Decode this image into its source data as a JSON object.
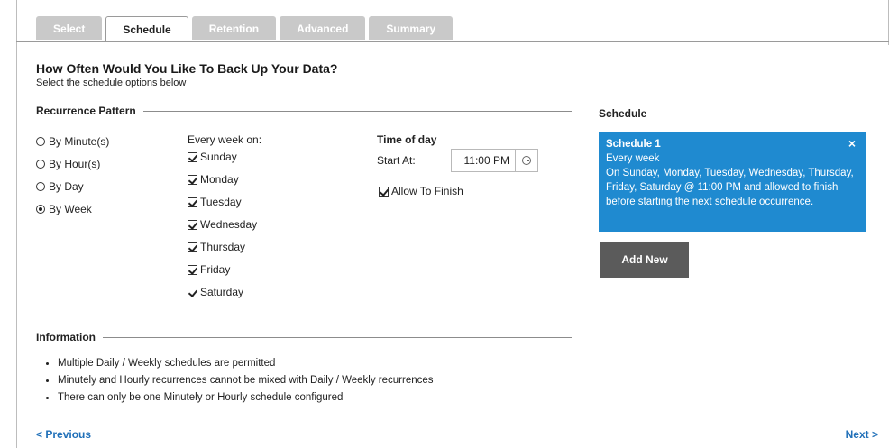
{
  "tabs": [
    {
      "label": "Select",
      "active": false
    },
    {
      "label": "Schedule",
      "active": true
    },
    {
      "label": "Retention",
      "active": false
    },
    {
      "label": "Advanced",
      "active": false
    },
    {
      "label": "Summary",
      "active": false
    }
  ],
  "page": {
    "heading": "How Often Would You Like To Back Up Your Data?",
    "subheading": "Select the schedule options below"
  },
  "recurrence": {
    "title": "Recurrence Pattern",
    "options": [
      {
        "label": "By Minute(s)",
        "selected": false
      },
      {
        "label": "By Hour(s)",
        "selected": false
      },
      {
        "label": "By Day",
        "selected": false
      },
      {
        "label": "By Week",
        "selected": true
      }
    ],
    "week_label": "Every week on:",
    "days": [
      {
        "label": "Sunday",
        "checked": true
      },
      {
        "label": "Monday",
        "checked": true
      },
      {
        "label": "Tuesday",
        "checked": true
      },
      {
        "label": "Wednesday",
        "checked": true
      },
      {
        "label": "Thursday",
        "checked": true
      },
      {
        "label": "Friday",
        "checked": true
      },
      {
        "label": "Saturday",
        "checked": true
      }
    ],
    "time_of_day_label": "Time of day",
    "start_at_label": "Start At:",
    "start_time": "11:00 PM",
    "allow_finish_label": "Allow To Finish",
    "allow_finish_checked": true
  },
  "schedule_panel": {
    "title": "Schedule",
    "card": {
      "name": "Schedule 1",
      "line1": "Every week",
      "description": "On Sunday, Monday, Tuesday, Wednesday, Thursday, Friday, Saturday @ 11:00 PM and allowed to finish before starting the next schedule occurrence.",
      "close_glyph": "×"
    },
    "add_new_label": "Add New",
    "accent_color": "#1f8ad0"
  },
  "information": {
    "title": "Information",
    "items": [
      "Multiple Daily / Weekly schedules are permitted",
      "Minutely and Hourly recurrences cannot be mixed with Daily / Weekly recurrences",
      "There can only be one Minutely or Hourly schedule configured"
    ]
  },
  "nav": {
    "previous_label": "< Previous",
    "next_label": "Next >"
  }
}
